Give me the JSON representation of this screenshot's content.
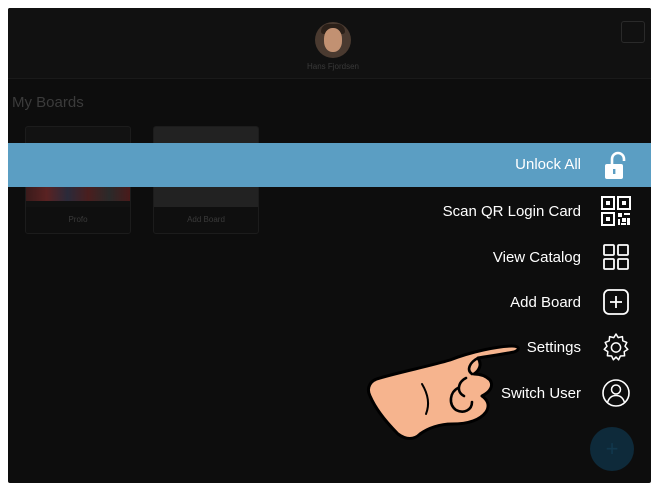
{
  "header": {
    "username": "Hans Fjordsen",
    "settings_icon": "window-icon"
  },
  "boards": {
    "section_title": "My Boards",
    "items": [
      {
        "label": "Profo"
      },
      {
        "label": "Add Board"
      }
    ]
  },
  "menu": {
    "items": [
      {
        "label": "Unlock All",
        "icon": "unlock-icon",
        "highlighted": true
      },
      {
        "label": "Scan QR Login Card",
        "icon": "qr-code-icon"
      },
      {
        "label": "View Catalog",
        "icon": "grid-icon"
      },
      {
        "label": "Add Board",
        "icon": "plus-box-icon"
      },
      {
        "label": "Settings",
        "icon": "gear-icon"
      },
      {
        "label": "Switch User",
        "icon": "user-circle-icon"
      }
    ]
  },
  "fab": {
    "label": "+"
  },
  "colors": {
    "highlight": "#5b9ec3",
    "background": "#0d0d0d",
    "hand_fill": "#f6b48e"
  }
}
